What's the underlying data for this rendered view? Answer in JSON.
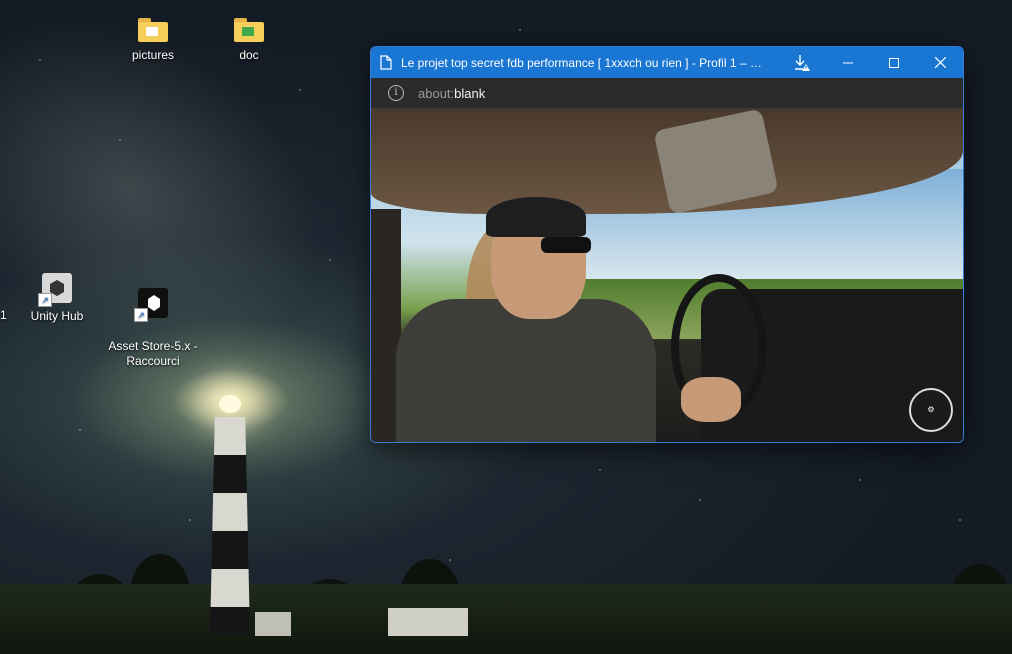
{
  "desktop": {
    "icons": [
      {
        "label": "pictures"
      },
      {
        "label": "doc"
      },
      {
        "label": "Unity Hub"
      },
      {
        "label": "Asset Store-5.x -\nRaccourci"
      }
    ],
    "edge_label": "1"
  },
  "browser": {
    "title": "Le projet top secret fdb performance [ 1xxxch ou rien ] - Profil 1 – Micr...",
    "address": {
      "protocol": "about:",
      "page": "blank"
    },
    "accent_color": "#1976d2",
    "icons": [
      "page-icon",
      "download-warning-icon",
      "minimize-icon",
      "maximize-icon",
      "close-icon",
      "info-icon"
    ]
  }
}
